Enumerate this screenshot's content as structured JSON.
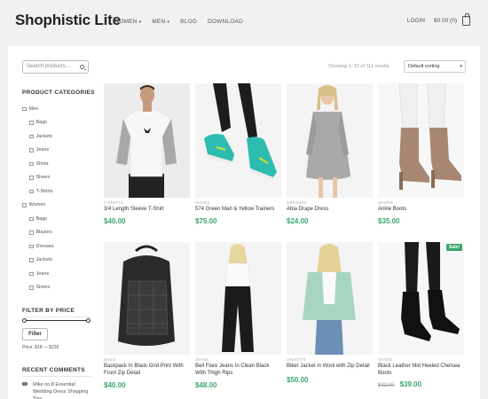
{
  "header": {
    "logo": "Shophistic Lite",
    "nav": [
      {
        "label": "WOMEN",
        "caret": "▾"
      },
      {
        "label": "MEN",
        "caret": "▾"
      },
      {
        "label": "BLOG",
        "caret": ""
      },
      {
        "label": "DOWNLOAD",
        "caret": ""
      }
    ],
    "login": "LOGIN",
    "cart_total": "$0.00 (0)"
  },
  "sidebar": {
    "search_placeholder": "Search products…",
    "categories_heading": "PRODUCT CATEGORIES",
    "categories": [
      {
        "label": "Men",
        "sub": false
      },
      {
        "label": "Bags",
        "sub": true
      },
      {
        "label": "Jackets",
        "sub": true
      },
      {
        "label": "Jeans",
        "sub": true
      },
      {
        "label": "Shirts",
        "sub": true
      },
      {
        "label": "Shoes",
        "sub": true
      },
      {
        "label": "T-Shirts",
        "sub": true
      },
      {
        "label": "Women",
        "sub": false
      },
      {
        "label": "Bags",
        "sub": true
      },
      {
        "label": "Blazers",
        "sub": true
      },
      {
        "label": "Dresses",
        "sub": true
      },
      {
        "label": "Jackets",
        "sub": true
      },
      {
        "label": "Jeans",
        "sub": true
      },
      {
        "label": "Shoes",
        "sub": true
      }
    ],
    "filter_heading": "FILTER BY PRICE",
    "filter_button": "Filter",
    "price_range": "Price: $18 — $220",
    "comments_heading": "RECENT COMMENTS",
    "comment": "Mike on 8 Essential Wedding Dress Shopping Tips"
  },
  "toolbar": {
    "showing": "Showing 1–12 of 111 results",
    "sorting": "Default sorting"
  },
  "products": [
    {
      "category": "T-SHIRTS",
      "name": "3/4 Length Sleeve T-Shirt",
      "price": "$40.00",
      "old_price": ""
    },
    {
      "category": "SHOES",
      "name": "574 Green Marl & Yellow Trainers",
      "price": "$75.00",
      "old_price": ""
    },
    {
      "category": "DRESSES",
      "name": "Abia Drape Dress",
      "price": "$24.00",
      "old_price": ""
    },
    {
      "category": "SHOES",
      "name": "Ankle Boots",
      "price": "$35.00",
      "old_price": ""
    },
    {
      "category": "BAGS",
      "name": "Backpack In Black Grid Print With Front Zip Detail",
      "price": "$40.00",
      "old_price": ""
    },
    {
      "category": "JEANS",
      "name": "Bell Flare Jeans In Clean Black With Thigh Rips",
      "price": "$48.00",
      "old_price": ""
    },
    {
      "category": "JACKETS",
      "name": "Biker Jacket in Wool with Zip Detail",
      "price": "$50.00",
      "old_price": ""
    },
    {
      "category": "SHOES",
      "name": "Black Leather Mid Heeled Chelsea Boots",
      "price": "$39.00",
      "old_price": "$42.00",
      "badge": "Sale!"
    }
  ],
  "colors": {
    "accent": "#3aa76d"
  }
}
